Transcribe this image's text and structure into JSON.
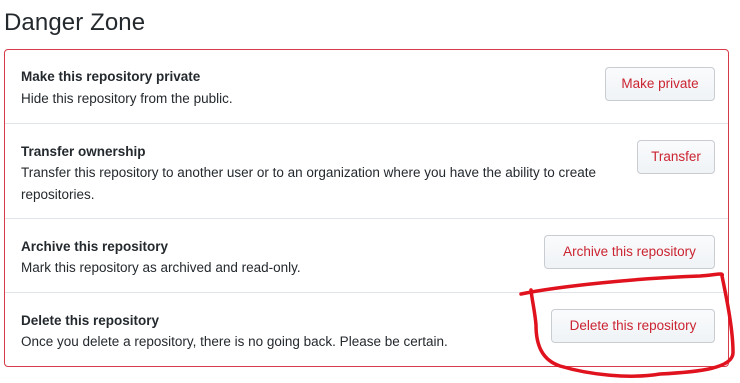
{
  "section": {
    "title": "Danger Zone"
  },
  "rows": [
    {
      "title": "Make this repository private",
      "description": "Hide this repository from the public.",
      "button": "Make private"
    },
    {
      "title": "Transfer ownership",
      "description": "Transfer this repository to another user or to an organization where you have the ability to create repositories.",
      "button": "Transfer"
    },
    {
      "title": "Archive this repository",
      "description": "Mark this repository as archived and read-only.",
      "button": "Archive this repository"
    },
    {
      "title": "Delete this repository",
      "description": "Once you delete a repository, there is no going back. Please be certain.",
      "button": "Delete this repository"
    }
  ],
  "colors": {
    "danger": "#d73a49",
    "danger_text": "#cb2431",
    "annotation": "#e0121e"
  }
}
